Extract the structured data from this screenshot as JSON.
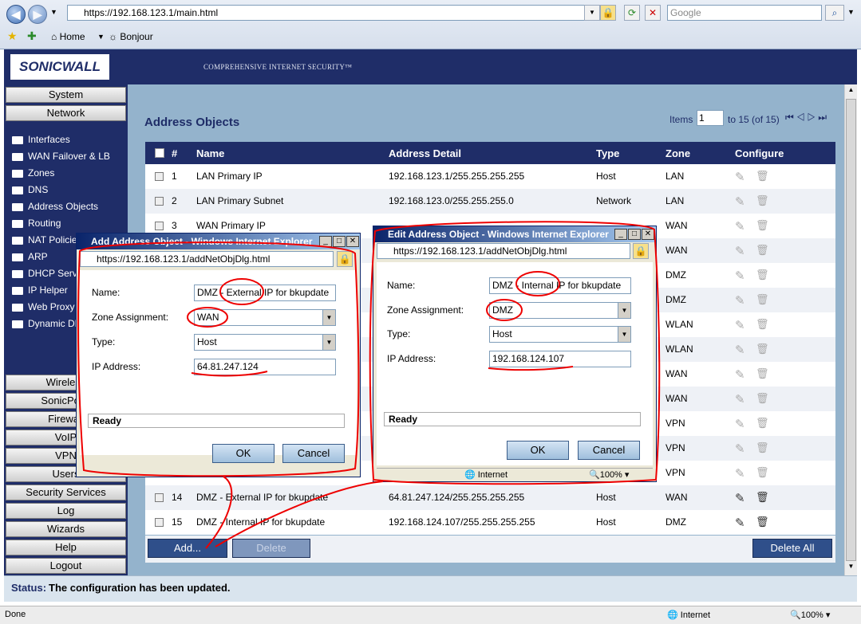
{
  "browser": {
    "url": "https://192.168.123.1/main.html",
    "search_placeholder": "Google",
    "favorites": {
      "home": "Home",
      "bonjour": "Bonjour"
    },
    "status": "Done",
    "zone": "Internet",
    "zoom": "100%"
  },
  "sonicwall": {
    "logo": "SONICWALL",
    "tagline": "COMPREHENSIVE INTERNET SECURITY™"
  },
  "leftnav": {
    "system": "System",
    "network": "Network",
    "items": [
      "Interfaces",
      "WAN Failover & LB",
      "Zones",
      "DNS",
      "Address Objects",
      "Routing",
      "NAT Policies",
      "ARP",
      "DHCP Server",
      "IP Helper",
      "Web Proxy",
      "Dynamic DNS"
    ],
    "lower": [
      "Wireless",
      "SonicPoint",
      "Firewall",
      "VoIP",
      "VPN",
      "Users",
      "Security Services",
      "Log",
      "Wizards",
      "Help",
      "Logout"
    ]
  },
  "page": {
    "title": "Address Objects",
    "items_label": "Items",
    "items_value": "1",
    "items_range": "to 15 (of 15)"
  },
  "table": {
    "headers": {
      "num": "#",
      "name": "Name",
      "address": "Address Detail",
      "type": "Type",
      "zone": "Zone",
      "configure": "Configure"
    },
    "rows": [
      {
        "num": "1",
        "name": "LAN Primary IP",
        "address": "192.168.123.1/255.255.255.255",
        "type": "Host",
        "zone": "LAN"
      },
      {
        "num": "2",
        "name": "LAN Primary Subnet",
        "address": "192.168.123.0/255.255.255.0",
        "type": "Network",
        "zone": "LAN"
      },
      {
        "num": "3",
        "name": "WAN Primary IP",
        "address": "",
        "type": "",
        "zone": "WAN"
      },
      {
        "num": "",
        "name": "",
        "address": "",
        "type": "",
        "zone": "WAN"
      },
      {
        "num": "",
        "name": "",
        "address": "",
        "type": "",
        "zone": "DMZ"
      },
      {
        "num": "",
        "name": "",
        "address": "",
        "type": "",
        "zone": "DMZ"
      },
      {
        "num": "",
        "name": "",
        "address": "",
        "type": "",
        "zone": "WLAN"
      },
      {
        "num": "",
        "name": "",
        "address": "",
        "type": "",
        "zone": "WLAN"
      },
      {
        "num": "",
        "name": "",
        "address": "",
        "type": "",
        "zone": "WAN"
      },
      {
        "num": "",
        "name": "",
        "address": "",
        "type": "",
        "zone": "WAN"
      },
      {
        "num": "",
        "name": "",
        "address": "",
        "type": "",
        "zone": "VPN"
      },
      {
        "num": "",
        "name": "",
        "address": "",
        "type": "",
        "zone": "VPN"
      },
      {
        "num": "",
        "name": "",
        "address": "",
        "type": "",
        "zone": "VPN"
      },
      {
        "num": "14",
        "name": "DMZ - External IP for bkupdate",
        "address": "64.81.247.124/255.255.255.255",
        "type": "Host",
        "zone": "WAN"
      },
      {
        "num": "15",
        "name": "DMZ - Internal IP for bkupdate",
        "address": "192.168.124.107/255.255.255.255",
        "type": "Host",
        "zone": "DMZ"
      }
    ],
    "add_label": "Add...",
    "delete_label": "Delete",
    "delete_all_label": "Delete All"
  },
  "status": {
    "label": "Status:",
    "message": "The configuration has been updated."
  },
  "add_dialog": {
    "title": "Add Address Object - Windows Internet Explorer",
    "url": "https://192.168.123.1/addNetObjDlg.html",
    "name_label": "Name:",
    "name_value": "DMZ - External IP for bkupdate",
    "zone_label": "Zone Assignment:",
    "zone_value": "WAN",
    "type_label": "Type:",
    "type_value": "Host",
    "ip_label": "IP Address:",
    "ip_value": "64.81.247.124",
    "status": "Ready",
    "ok": "OK",
    "cancel": "Cancel"
  },
  "edit_dialog": {
    "title": "Edit Address Object - Windows Internet Explorer",
    "url": "https://192.168.123.1/addNetObjDlg.html",
    "name_label": "Name:",
    "name_value": "DMZ - Internal IP for bkupdate",
    "zone_label": "Zone Assignment:",
    "zone_value": "DMZ",
    "type_label": "Type:",
    "type_value": "Host",
    "ip_label": "IP Address:",
    "ip_value": "192.168.124.107",
    "status": "Ready",
    "ok": "OK",
    "cancel": "Cancel",
    "zone_bar": "Internet",
    "zoom": "100%"
  }
}
